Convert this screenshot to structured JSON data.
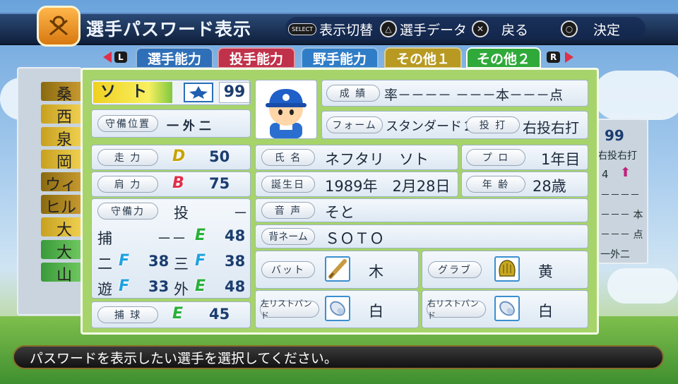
{
  "header": {
    "title": "選手パスワード表示"
  },
  "hints": {
    "select_tag": "SELECT",
    "toggle": "表示切替",
    "player_data": "選手データ",
    "back": "戻る",
    "decide": "決定"
  },
  "tabs": {
    "l": "L",
    "r": "R",
    "items": [
      "選手能力",
      "投手能力",
      "野手能力",
      "その他１",
      "その他２"
    ],
    "active": "その他２"
  },
  "side_list": [
    "桑",
    "西",
    "泉",
    "岡",
    "ウィ",
    "ヒル",
    "大",
    "大",
    "山"
  ],
  "right_panel": {
    "num": "99",
    "line1": "右投右打",
    "line2": "4",
    "line3": "－－－－",
    "line4": "－－－ 本",
    "line5": "－－－ 点",
    "line6": "一外二"
  },
  "player": {
    "name_short": "ソ　ト",
    "number": "99",
    "position_label": "守備位置",
    "position_value": "一 外 二",
    "record_label": "成 績",
    "record_value": "率－－－－ －－－本－－－点",
    "form_label": "フォーム",
    "form_value": "スタンダード２５",
    "throw_label": "投 打",
    "throw_value": "右投右打"
  },
  "stats": {
    "run": {
      "label": "走 力",
      "grade": "D",
      "value": "50"
    },
    "arm": {
      "label": "肩 力",
      "grade": "B",
      "value": "75"
    },
    "field": {
      "label": "守備力",
      "pos": "投",
      "value": "－"
    },
    "catcher": {
      "pos": "捕",
      "dash": "－－",
      "grade": "E",
      "value": "48"
    },
    "second": {
      "pos": "二",
      "grade": "F",
      "value": "38"
    },
    "third": {
      "pos": "三",
      "grade": "F",
      "value": "38"
    },
    "short": {
      "pos": "遊",
      "grade": "F",
      "value": "33"
    },
    "outfield": {
      "pos": "外",
      "grade": "E",
      "value": "48"
    },
    "catch": {
      "label": "捕 球",
      "grade": "E",
      "value": "45"
    }
  },
  "profile": {
    "name_label": "氏 名",
    "name_value": "ネフタリ　ソト",
    "pro_label": "プ ロ",
    "pro_value": "1年目",
    "birth_label": "誕生日",
    "birth_value": "1989年　2月28日",
    "age_label": "年 齢",
    "age_value": "28歳",
    "voice_label": "音 声",
    "voice_value": "そと",
    "back_label": "背ネーム",
    "back_value": "ＳＯＴＯ",
    "bat_label": "バット",
    "bat_value": "木",
    "glove_label": "グラブ",
    "glove_value": "黄",
    "lwrist_label": "左リストバンド",
    "lwrist_value": "白",
    "rwrist_label": "右リストバンド",
    "rwrist_value": "白"
  },
  "message": "パスワードを表示したい選手を選択してください。",
  "colors": {
    "tab_skill": "#2e6fb8",
    "tab_pitch": "#c0314a",
    "tab_field": "#2f7dc7",
    "tab_other1": "#b89a22",
    "tab_other2": "#2faa3a"
  }
}
